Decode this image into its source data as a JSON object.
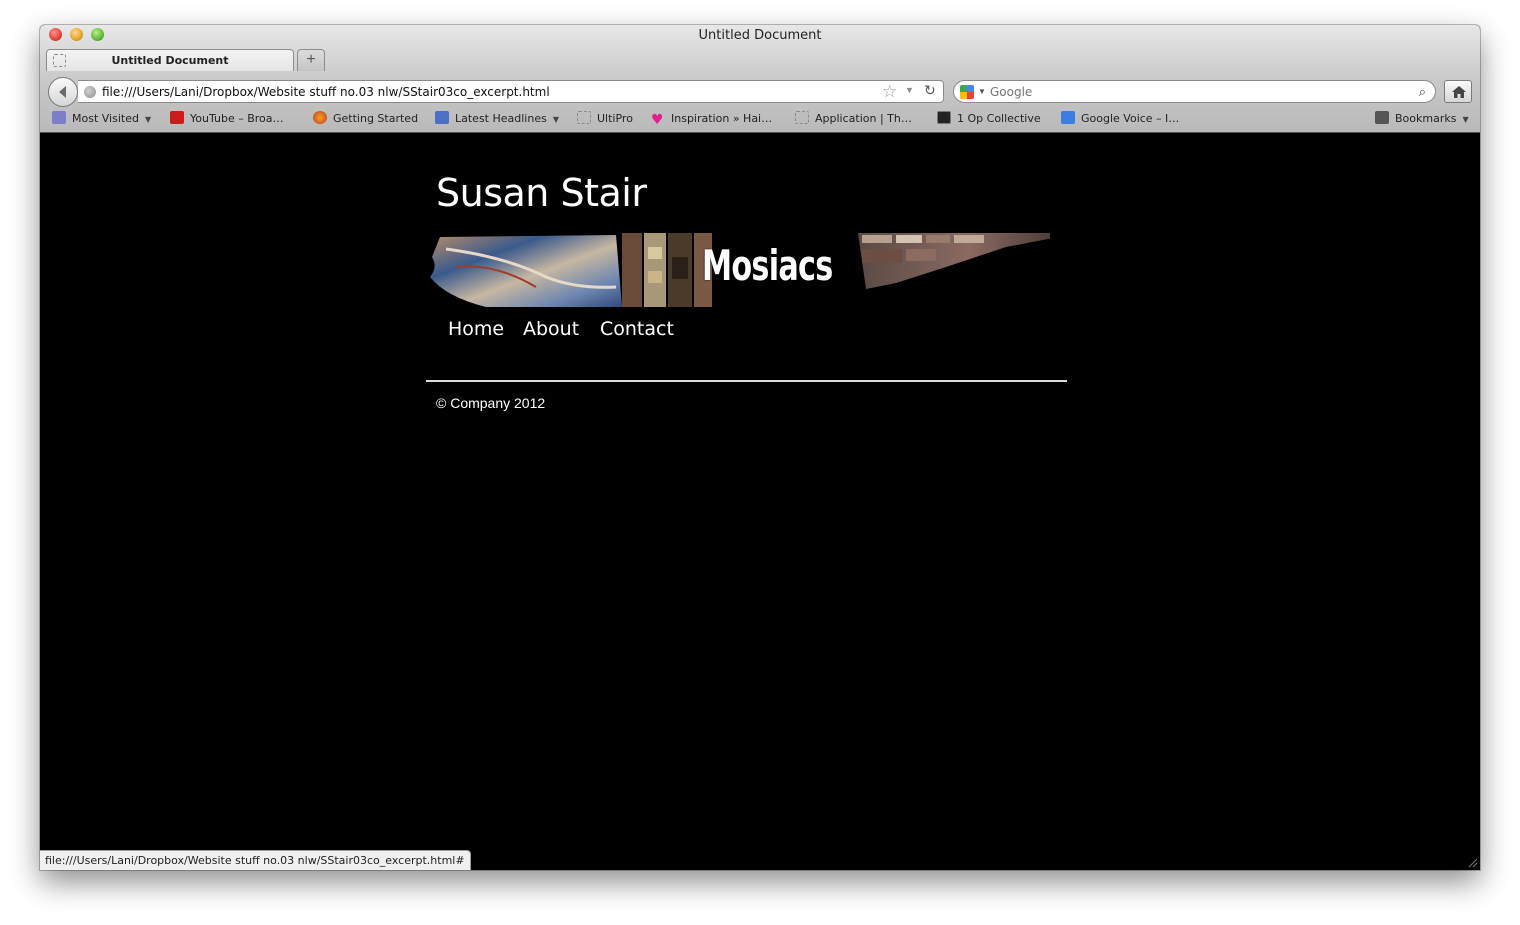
{
  "window": {
    "title": "Untitled Document"
  },
  "tabs": [
    {
      "label": "Untitled Document"
    }
  ],
  "new_tab_label": "+",
  "navbar": {
    "url": "file:///Users/Lani/Dropbox/Website stuff no.03 nlw/SStair03co_excerpt.html",
    "search_placeholder": "Google"
  },
  "bookmarks": [
    {
      "label": "Most Visited",
      "icon": "most-visited-icon",
      "dropdown": true
    },
    {
      "label": "YouTube – Broa…",
      "icon": "youtube-icon"
    },
    {
      "label": "Getting Started",
      "icon": "firefox-icon"
    },
    {
      "label": "Latest Headlines",
      "icon": "rss-icon",
      "dropdown": true
    },
    {
      "label": "UltiPro",
      "icon": "page-icon"
    },
    {
      "label": "Inspiration » Hai…",
      "icon": "heart-icon"
    },
    {
      "label": "Application | Th…",
      "icon": "page-icon"
    },
    {
      "label": "1 Op Collective",
      "icon": "op-collective-icon"
    },
    {
      "label": "Google Voice – I…",
      "icon": "phone-icon"
    },
    {
      "label": "Bookmarks",
      "icon": "bookmarks-icon",
      "dropdown": true
    }
  ],
  "site": {
    "title": "Susan Stair",
    "banner_text": "Mosiacs",
    "nav": [
      "Home",
      "About",
      "Contact"
    ],
    "copyright": "© Company 2012"
  },
  "status": {
    "text": "file:///Users/Lani/Dropbox/Website stuff no.03 nlw/SStair03co_excerpt.html#"
  }
}
